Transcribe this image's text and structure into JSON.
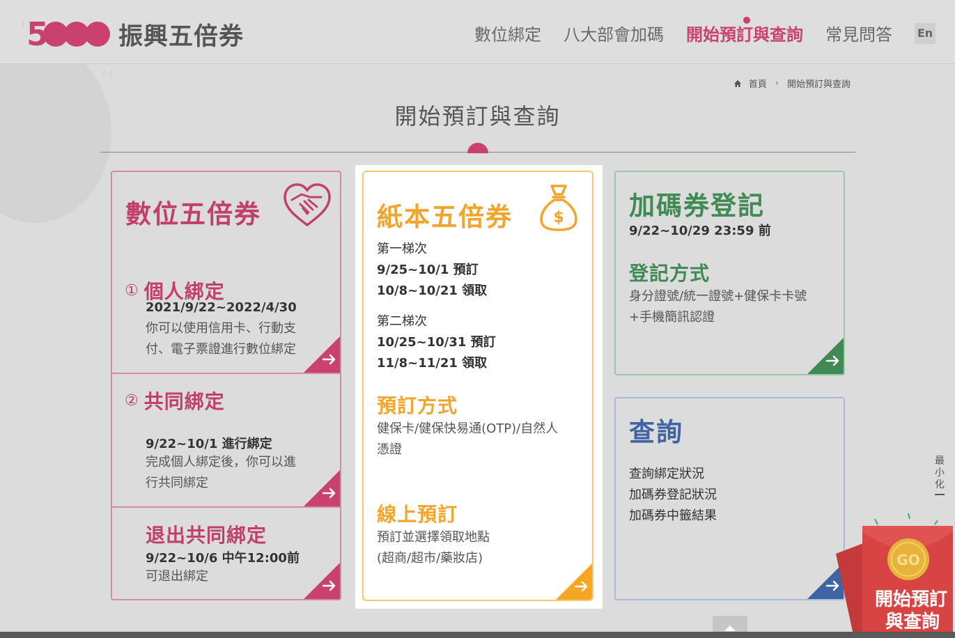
{
  "header": {
    "logo_number": "5",
    "logo_text": "振興五倍券",
    "nav": [
      {
        "label": "數位綁定"
      },
      {
        "label": "八大部會加碼"
      },
      {
        "label": "開始預訂與查詢"
      },
      {
        "label": "常見問答"
      }
    ],
    "lang_button": "En"
  },
  "breadcrumb": {
    "home": "首頁",
    "current": "開始預訂與查詢"
  },
  "page_title": "開始預訂與查詢",
  "digital": {
    "title": "數位五倍券",
    "personal": {
      "number": "①",
      "title": "個人綁定",
      "date": "2021/9/22~2022/4/30",
      "desc_1": "你可以使用信用卡、行動支",
      "desc_2": "付、電子票證進行數位綁定"
    },
    "joint": {
      "number": "②",
      "title": "共同綁定",
      "date": "9/22~10/1 進行綁定",
      "desc_1": "完成個人綁定後，你可以進",
      "desc_2": "行共同綁定"
    },
    "exit": {
      "title": "退出共同綁定",
      "date": "9/22~10/6 中午12:00前",
      "desc": "可退出綁定"
    }
  },
  "paper": {
    "title": "紙本五倍券",
    "batch1_label": "第一梯次",
    "batch1_reserve": "9/25~10/1 預訂",
    "batch1_pickup": "10/8~10/21 領取",
    "batch2_label": "第二梯次",
    "batch2_reserve": "10/25~10/31 預訂",
    "batch2_pickup": "11/8~11/21 領取",
    "method_title": "預訂方式",
    "method_1": "健保卡/健保快易通(OTP)/自然人",
    "method_2": "憑證",
    "online_title": "線上預訂",
    "online_1": "預訂並選擇領取地點",
    "online_2": "(超商/超市/藥妝店)"
  },
  "bonus": {
    "title": "加碼券登記",
    "date": "9/22~10/29 23:59 前",
    "method_title": "登記方式",
    "method_1": "身分證號/統一證號+健保卡卡號",
    "method_2": "+手機簡訊認證"
  },
  "query": {
    "title": "查詢",
    "item_1": "查詢綁定狀況",
    "item_2": "加碼券登記狀況",
    "item_3": "加碼券中籤結果"
  },
  "minimize": {
    "c1": "最",
    "c2": "小",
    "c3": "化"
  },
  "promo": {
    "go": "GO",
    "line1": "開始預訂",
    "line2": "與查詢"
  },
  "colors": {
    "pink": "#c0406a",
    "orange": "#f1a52c",
    "green": "#3f8a55",
    "blue": "#3f63a3"
  },
  "icons": [
    "home-icon",
    "handshake-heart-icon",
    "money-bag-icon",
    "arrow-right-icon",
    "arrow-up-icon"
  ]
}
